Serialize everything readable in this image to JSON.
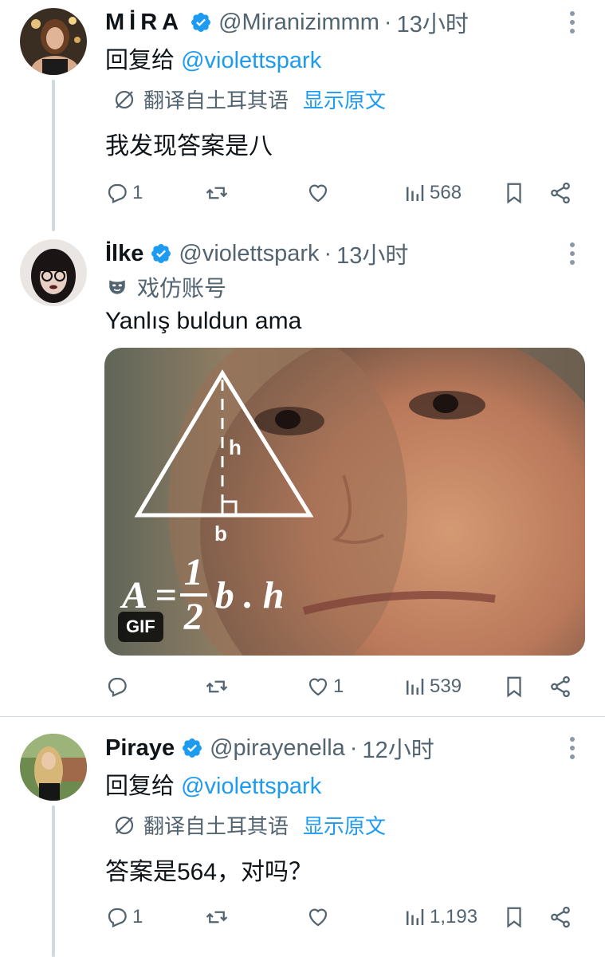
{
  "tweets": [
    {
      "name": "MİRA",
      "handle": "@Miranizimmm",
      "time": "13小时",
      "reply_prefix": "回复给",
      "reply_mention": "@violettspark",
      "translate_label": "翻译自土耳其语",
      "show_original": "显示原文",
      "text": "我发现答案是八",
      "replies": "1",
      "retweets": "",
      "likes": "",
      "views": "568"
    },
    {
      "name": "İlke",
      "handle": "@violettspark",
      "time": "13小时",
      "parody_label": "戏仿账号",
      "text": "Yanlış buldun ama",
      "media": {
        "gif_label": "GIF",
        "formula_left": "A = ",
        "formula_num": "1",
        "formula_den": "2",
        "formula_right": "b . h",
        "label_h": "h",
        "label_b": "b"
      },
      "replies": "",
      "retweets": "",
      "likes": "1",
      "views": "539"
    },
    {
      "name": "Piraye",
      "handle": "@pirayenella",
      "time": "12小时",
      "reply_prefix": "回复给",
      "reply_mention": "@violettspark",
      "translate_label": "翻译自土耳其语",
      "show_original": "显示原文",
      "text": "答案是564，对吗？",
      "replies": "1",
      "retweets": "",
      "likes": "",
      "views": "1,193"
    }
  ],
  "dot": "·",
  "colors": {
    "link": "#1d9bf0",
    "secondary": "#536471",
    "verified": "#1d9bf0"
  }
}
